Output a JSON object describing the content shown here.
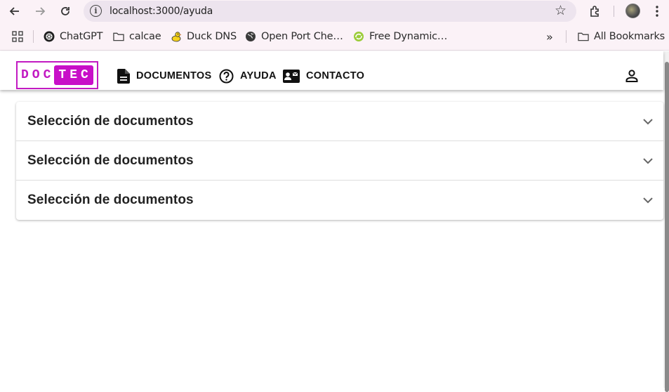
{
  "browser": {
    "url": "localhost:3000/ayuda",
    "bookmarks": [
      {
        "label": "ChatGPT",
        "icon": "chatgpt-icon"
      },
      {
        "label": "calcae",
        "icon": "folder-icon"
      },
      {
        "label": "Duck DNS",
        "icon": "duck-icon"
      },
      {
        "label": "Open Port Che…",
        "icon": "globe-icon"
      },
      {
        "label": "Free Dynamic…",
        "icon": "dynamic-dns-icon"
      }
    ],
    "more_bookmarks": "»",
    "all_bookmarks": "All Bookmarks"
  },
  "app": {
    "logo_left": "DOC",
    "logo_right": "TEC",
    "brand_color": "#c80fc8",
    "nav": [
      {
        "label": "DOCUMENTOS",
        "icon": "document-icon"
      },
      {
        "label": "AYUDA",
        "icon": "help-icon"
      },
      {
        "label": "CONTACTO",
        "icon": "contact-card-icon"
      }
    ]
  },
  "accordion": {
    "items": [
      {
        "title": "Selección de documentos"
      },
      {
        "title": "Selección de documentos"
      },
      {
        "title": "Selección de documentos"
      }
    ]
  }
}
